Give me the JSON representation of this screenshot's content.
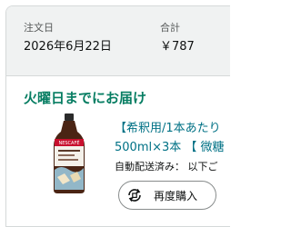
{
  "order": {
    "date_label": "注文日",
    "date_value": "2026年6月22日",
    "total_label": "合計",
    "total_value": "￥787"
  },
  "delivery": {
    "status": "火曜日までにお届け"
  },
  "item": {
    "image_icon": "coffee-bottle-image",
    "title_line1": "【希釈用/1本あたり",
    "title_line2": "500ml×3本 【 微糖",
    "subscription_note": "自動配送済み： 以下ご",
    "rebuy_icon": "rebuy-cycle-icon",
    "rebuy_label": "再度購入"
  },
  "colors": {
    "header_bg": "#f0f2f2",
    "border": "#d5d9d9",
    "delivery_green": "#067d62",
    "link_teal": "#007185"
  }
}
